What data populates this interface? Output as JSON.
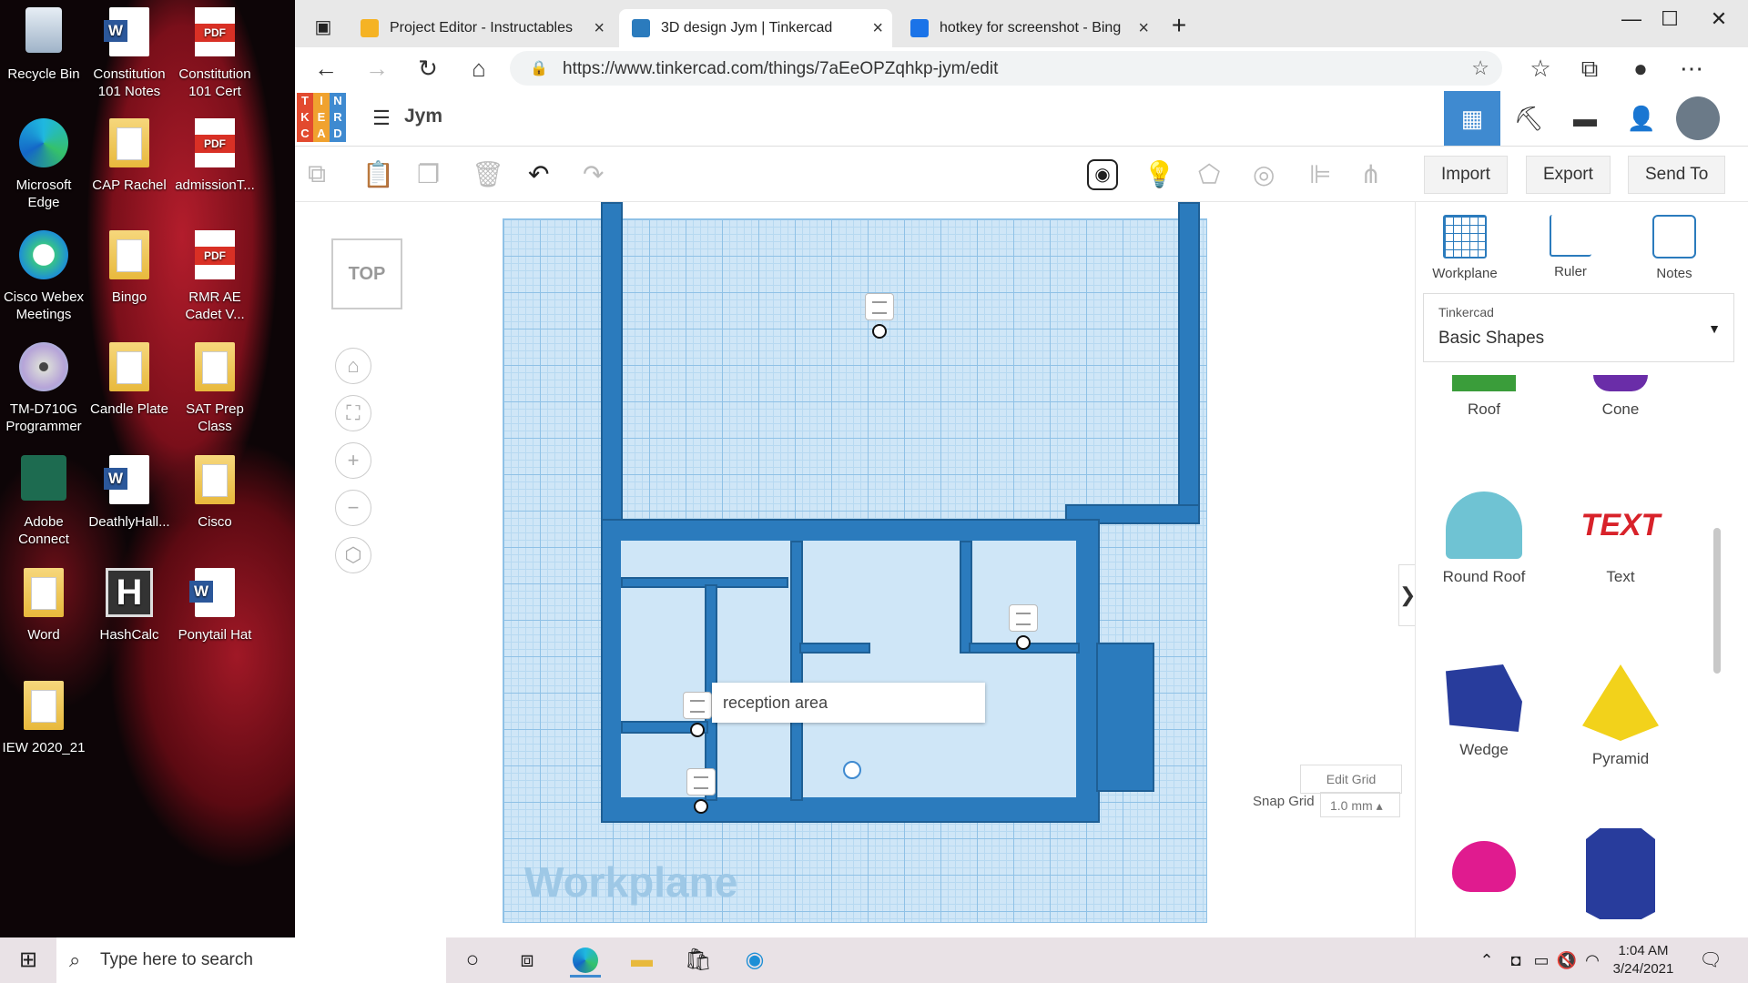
{
  "desktop": {
    "icons": [
      {
        "label": "Recycle Bin",
        "icon": "recycle-bin-icon"
      },
      {
        "label": "Constitution 101 Notes",
        "icon": "word-doc-icon"
      },
      {
        "label": "Constitution 101 Cert",
        "icon": "pdf-icon"
      },
      {
        "label": "Microsoft Edge",
        "icon": "edge-icon"
      },
      {
        "label": "CAP Rachel",
        "icon": "folder-icon"
      },
      {
        "label": "admissionT...",
        "icon": "pdf-icon"
      },
      {
        "label": "Cisco Webex Meetings",
        "icon": "webex-icon"
      },
      {
        "label": "Bingo",
        "icon": "folder-icon"
      },
      {
        "label": "RMR AE Cadet V...",
        "icon": "pdf-icon"
      },
      {
        "label": "TM-D710G Programmer",
        "icon": "disc-icon"
      },
      {
        "label": "Candle Plate",
        "icon": "folder-icon"
      },
      {
        "label": "SAT Prep Class",
        "icon": "folder-icon"
      },
      {
        "label": "Adobe Connect",
        "icon": "adobe-connect-icon"
      },
      {
        "label": "DeathlyHall...",
        "icon": "word-doc-icon"
      },
      {
        "label": "Cisco",
        "icon": "folder-icon"
      },
      {
        "label": "Word",
        "icon": "folder-icon"
      },
      {
        "label": "HashCalc",
        "icon": "hashcalc-icon"
      },
      {
        "label": "Ponytail Hat",
        "icon": "word-doc-icon"
      },
      {
        "label": "IEW 2020_21",
        "icon": "folder-icon"
      }
    ],
    "pdf_badge": "PDF",
    "word_badge": "W"
  },
  "browser": {
    "tabs": [
      {
        "title": "Project Editor - Instructables",
        "favicon_color": "#f5b324"
      },
      {
        "title": "3D design Jym | Tinkercad",
        "favicon_color": "#2b7bbd"
      },
      {
        "title": "hotkey for screenshot - Bing",
        "favicon_color": "#1a73e8"
      }
    ],
    "url": "https://www.tinkercad.com/things/7aEeOPZqhkp-jym/edit",
    "new_tab": "+"
  },
  "tinkercad": {
    "logo_letters": [
      "T",
      "I",
      "N",
      "K",
      "E",
      "R",
      "C",
      "A",
      "D"
    ],
    "logo_colors": [
      "#e24a2f",
      "#f0a22f",
      "#3f8ad0",
      "#e24a2f",
      "#f0a22f",
      "#3f8ad0",
      "#e24a2f",
      "#f0a22f",
      "#3f8ad0"
    ],
    "design_title": "Jym",
    "toolbar": {
      "import": "Import",
      "export": "Export",
      "send_to": "Send To"
    },
    "viewcube_label": "TOP",
    "workplane_label": "Workplane",
    "note_text": "reception area",
    "edit_grid": "Edit Grid",
    "snap_grid_label": "Snap Grid",
    "snap_grid_value": "1.0 mm",
    "sidebar": {
      "tools": [
        {
          "label": "Workplane",
          "icon": "workplane-icon"
        },
        {
          "label": "Ruler",
          "icon": "ruler-icon"
        },
        {
          "label": "Notes",
          "icon": "notes-icon"
        }
      ],
      "library_source": "Tinkercad",
      "library_name": "Basic Shapes",
      "shapes": [
        {
          "label": "Roof",
          "color": "#3a9d3a"
        },
        {
          "label": "Cone",
          "color": "#6a2da8"
        },
        {
          "label": "Round Roof",
          "color": "#6fc3d3"
        },
        {
          "label": "Text",
          "color": "#d8222a"
        },
        {
          "label": "Wedge",
          "color": "#283c9c"
        },
        {
          "label": "Pyramid",
          "color": "#f2d21b"
        },
        {
          "label": "",
          "color": "#e01b8f"
        },
        {
          "label": "",
          "color": "#283c9c"
        }
      ]
    }
  },
  "taskbar": {
    "search_placeholder": "Type here to search",
    "time": "1:04 AM",
    "date": "3/24/2021"
  }
}
